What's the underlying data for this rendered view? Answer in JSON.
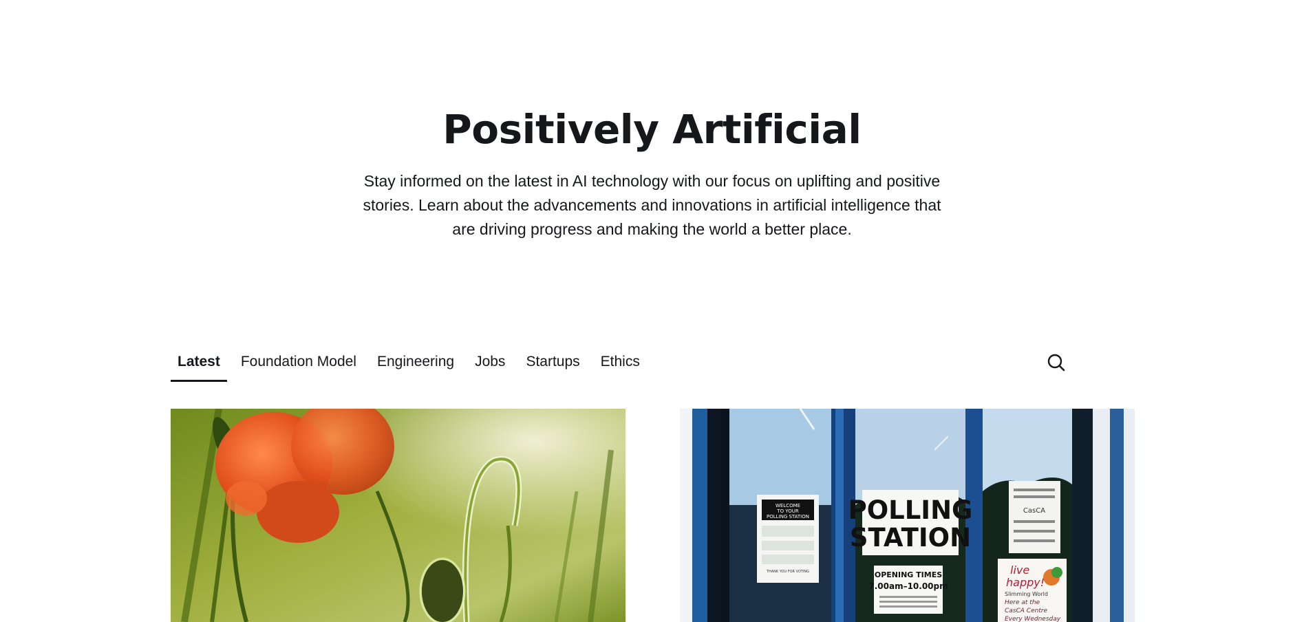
{
  "site": {
    "title": "Positively Artificial",
    "description": "Stay informed on the latest in AI technology with our focus on uplifting and positive stories. Learn about the advancements and innovations in artificial intelligence that are driving progress and making the world a better place."
  },
  "nav": {
    "tabs": [
      {
        "label": "Latest",
        "active": true
      },
      {
        "label": "Foundation Model",
        "active": false
      },
      {
        "label": "Engineering",
        "active": false
      },
      {
        "label": "Jobs",
        "active": false
      },
      {
        "label": "Startups",
        "active": false
      },
      {
        "label": "Ethics",
        "active": false
      }
    ],
    "search_icon": "search-icon"
  },
  "posts": [
    {
      "image_description": "poppy-flower-meadow"
    },
    {
      "image_description": "polling-station-doors",
      "signs": {
        "polling_line1": "POLLING",
        "polling_line2": "STATION",
        "opening_times_title": "OPENING TIMES",
        "opening_times_value": "7.00am–10.00pm",
        "welcome_line1": "WELCOME",
        "welcome_line2": "TO YOUR",
        "welcome_line3": "POLLING STATION",
        "thank_you": "THANK YOU FOR VOTING",
        "live": "live",
        "happy": "happy!",
        "slimming": "Slimming World",
        "here": "Here at the",
        "venue": "CasCA Centre",
        "every": "Every Wednesday",
        "right_notice": "CasCA"
      }
    }
  ],
  "colors": {
    "text": "#15171a",
    "background": "#ffffff"
  }
}
